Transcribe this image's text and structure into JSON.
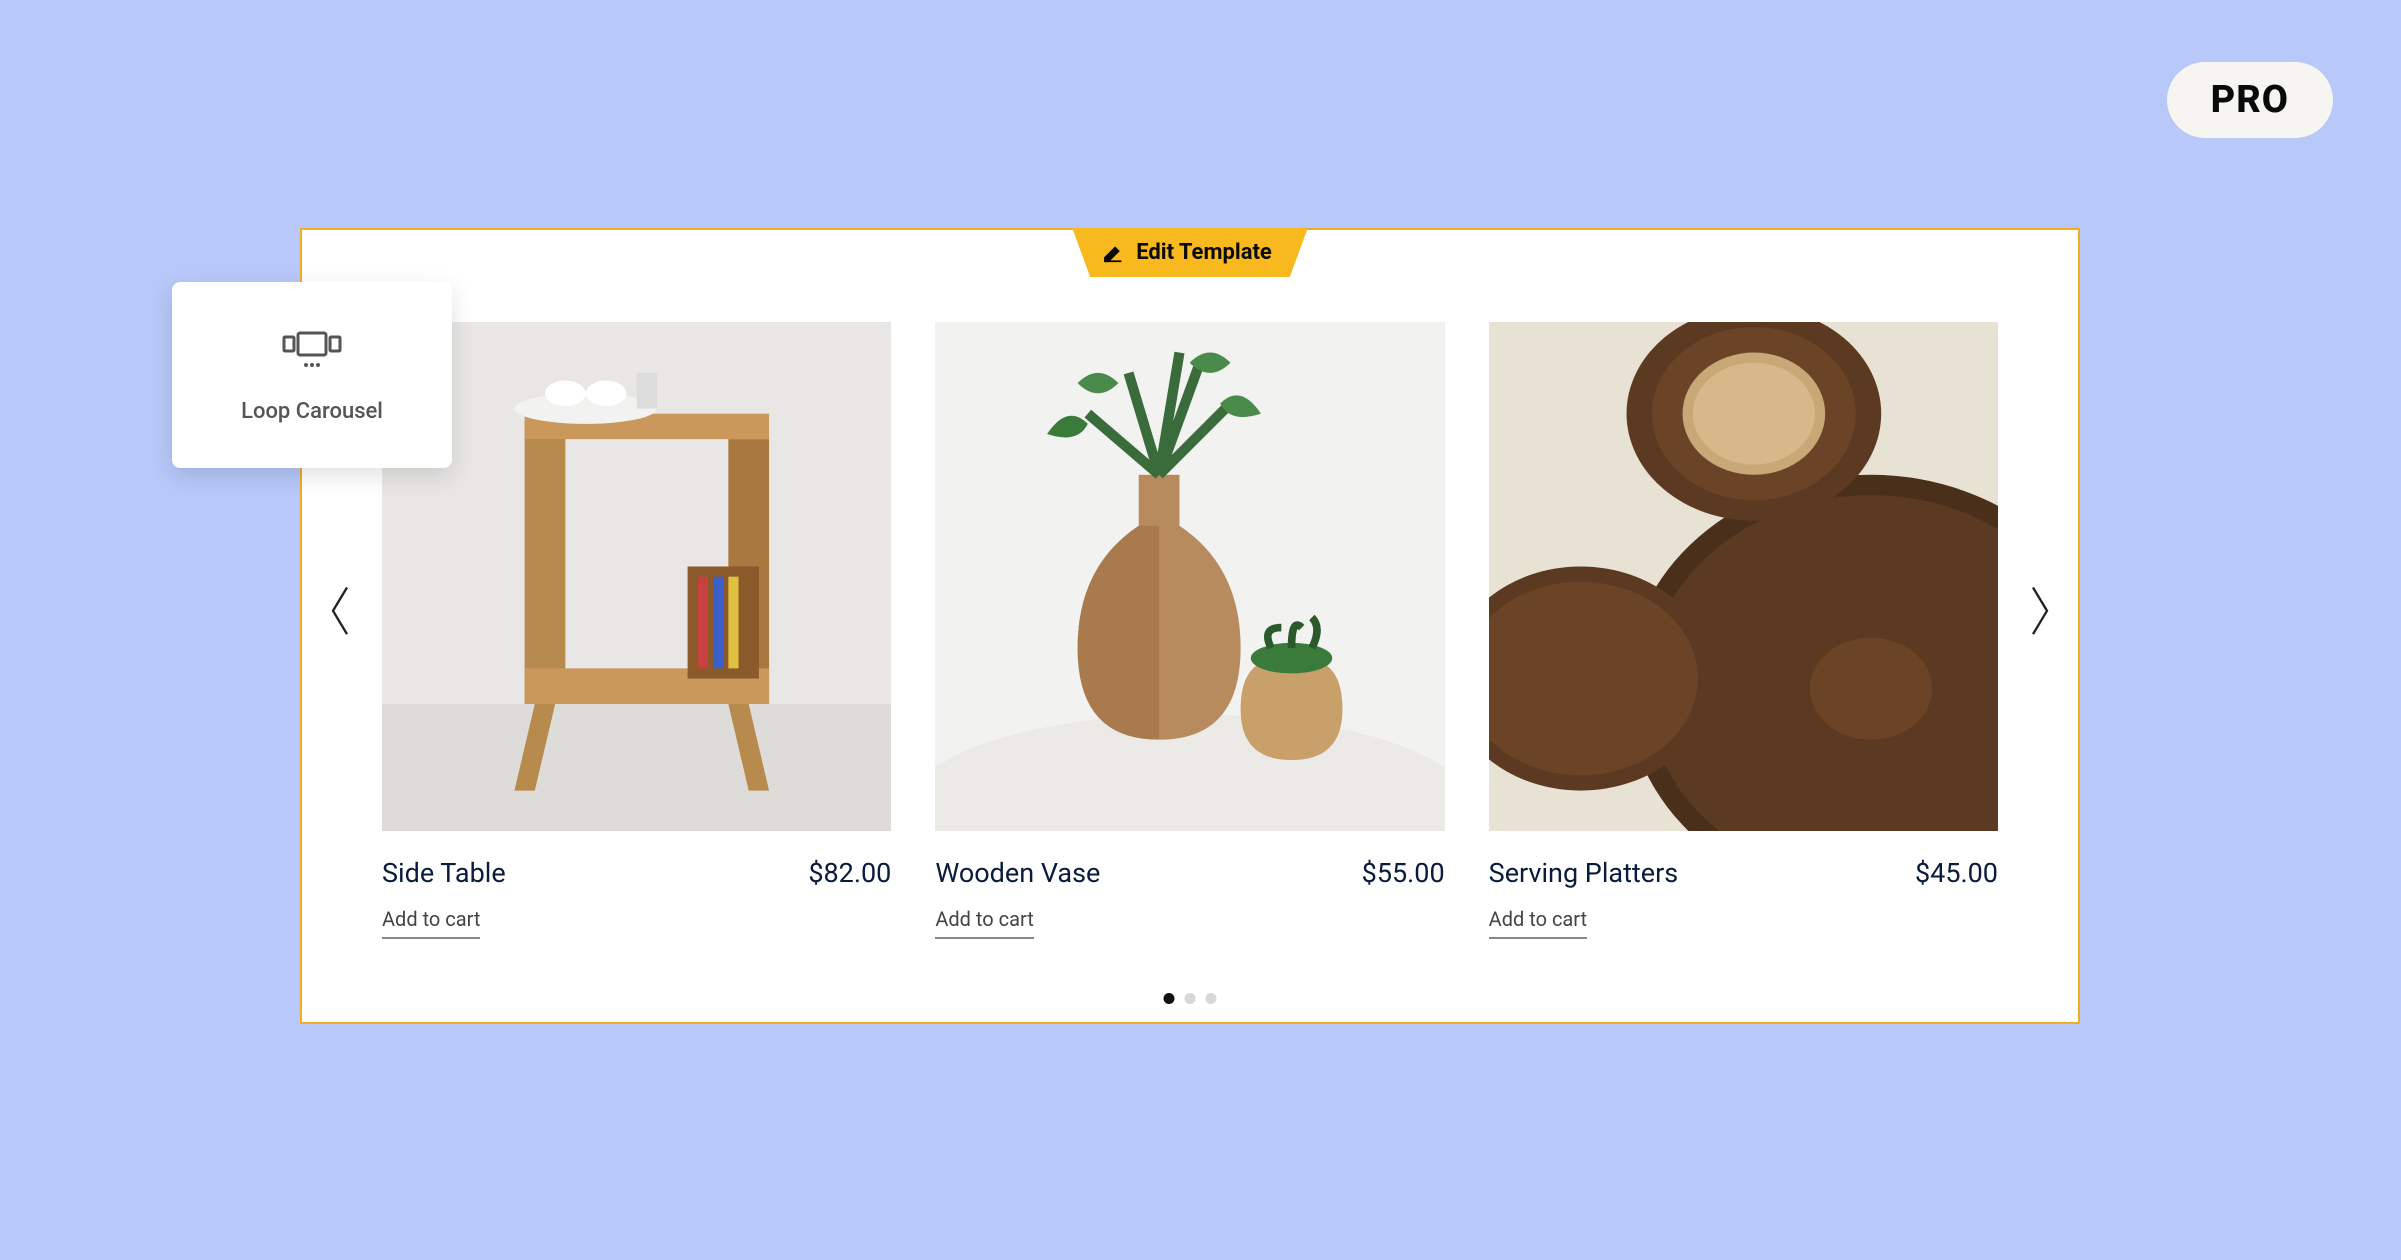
{
  "badge": {
    "label": "PRO"
  },
  "editTab": {
    "label": "Edit Template"
  },
  "widget": {
    "label": "Loop Carousel"
  },
  "products": [
    {
      "name": "Side Table",
      "price": "$82.00",
      "cta": "Add to cart"
    },
    {
      "name": "Wooden Vase",
      "price": "$55.00",
      "cta": "Add to cart"
    },
    {
      "name": "Serving Platters",
      "price": "$45.00",
      "cta": "Add to cart"
    }
  ],
  "pagination": {
    "total": 3,
    "active": 0
  }
}
